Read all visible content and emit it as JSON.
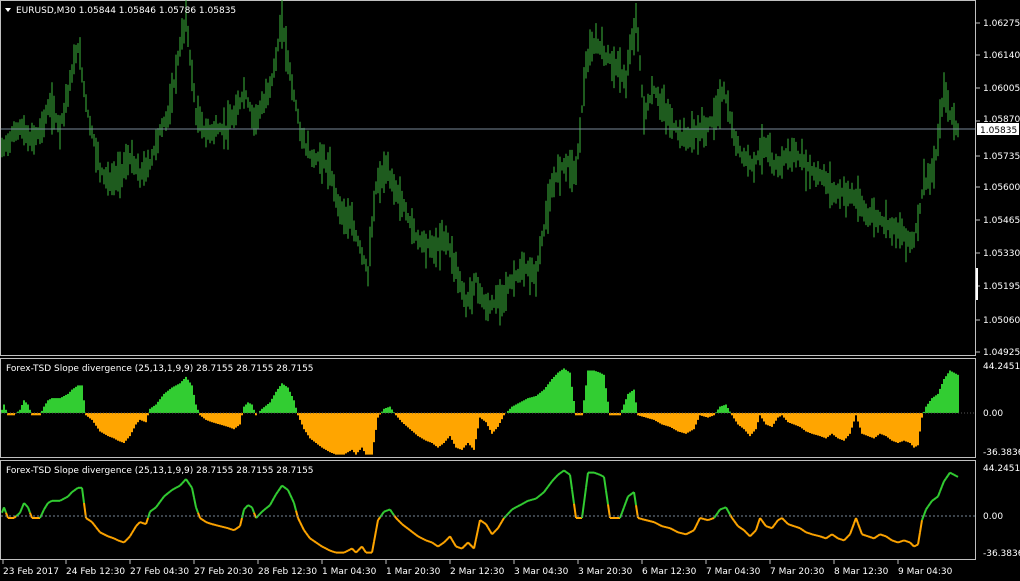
{
  "symbol_header": "EURUSD,M30  1.05844 1.05846 1.05786 1.05835",
  "current_price": "1.05835",
  "colors": {
    "background": "#000000",
    "frame": "#c0c0c0",
    "price_bars": "#3cb63c",
    "positive": "#32cd32",
    "negative": "#ffa500",
    "text": "#ffffff",
    "price_line": "#778899"
  },
  "price_axis": [
    "1.06275",
    "1.06140",
    "1.06005",
    "1.05870",
    "1.05735",
    "1.05600",
    "1.05465",
    "1.05330",
    "1.05195",
    "1.05060",
    "1.04925"
  ],
  "indicator1": {
    "title": "Forex-TSD Slope divergence (25,13,1,9,9) 28.7155 28.7155 28.7155",
    "axis": [
      "44.2451",
      "0.00",
      "-36.3836"
    ]
  },
  "indicator2": {
    "title": "Forex-TSD Slope divergence (25,13,1,9,9) 28.7155 28.7155 28.7155",
    "axis": [
      "44.2451",
      "0.00",
      "-36.3836"
    ]
  },
  "time_axis": [
    "23 Feb 2017",
    "24 Feb 12:30",
    "27 Feb 04:30",
    "27 Feb 20:30",
    "28 Feb 12:30",
    "1 Mar 04:30",
    "1 Mar 20:30",
    "2 Mar 12:30",
    "3 Mar 04:30",
    "3 Mar 20:30",
    "6 Mar 12:30",
    "7 Mar 04:30",
    "7 Mar 20:30",
    "8 Mar 12:30",
    "9 Mar 04:30"
  ],
  "chart_data": {
    "type": "line",
    "price_kp": [
      [
        0,
        1.0574
      ],
      [
        10,
        1.058
      ],
      [
        20,
        1.0585
      ],
      [
        30,
        1.0579
      ],
      [
        40,
        1.0583
      ],
      [
        50,
        1.0594
      ],
      [
        60,
        1.0585
      ],
      [
        70,
        1.0603
      ],
      [
        78,
        1.0618
      ],
      [
        88,
        1.059
      ],
      [
        100,
        1.0568
      ],
      [
        110,
        1.0562
      ],
      [
        120,
        1.0566
      ],
      [
        130,
        1.0572
      ],
      [
        140,
        1.0565
      ],
      [
        150,
        1.057
      ],
      [
        160,
        1.0583
      ],
      [
        170,
        1.0592
      ],
      [
        178,
        1.0613
      ],
      [
        186,
        1.063
      ],
      [
        196,
        1.059
      ],
      [
        206,
        1.0582
      ],
      [
        216,
        1.0584
      ],
      [
        226,
        1.0584
      ],
      [
        236,
        1.059
      ],
      [
        244,
        1.06
      ],
      [
        254,
        1.0588
      ],
      [
        264,
        1.0594
      ],
      [
        274,
        1.0608
      ],
      [
        282,
        1.0628
      ],
      [
        292,
        1.0602
      ],
      [
        302,
        1.058
      ],
      [
        312,
        1.0572
      ],
      [
        322,
        1.0572
      ],
      [
        330,
        1.0566
      ],
      [
        340,
        1.0551
      ],
      [
        350,
        1.0546
      ],
      [
        360,
        1.0536
      ],
      [
        368,
        1.0525
      ],
      [
        376,
        1.056
      ],
      [
        386,
        1.0567
      ],
      [
        396,
        1.0559
      ],
      [
        406,
        1.055
      ],
      [
        416,
        1.054
      ],
      [
        426,
        1.0537
      ],
      [
        436,
        1.0535
      ],
      [
        446,
        1.054
      ],
      [
        456,
        1.0527
      ],
      [
        466,
        1.0512
      ],
      [
        476,
        1.0522
      ],
      [
        486,
        1.051
      ],
      [
        496,
        1.0513
      ],
      [
        506,
        1.0518
      ],
      [
        516,
        1.0524
      ],
      [
        526,
        1.0526
      ],
      [
        536,
        1.0524
      ],
      [
        546,
        1.0548
      ],
      [
        556,
        1.0565
      ],
      [
        566,
        1.0571
      ],
      [
        576,
        1.0566
      ],
      [
        586,
        1.061
      ],
      [
        596,
        1.062
      ],
      [
        606,
        1.0614
      ],
      [
        616,
        1.061
      ],
      [
        626,
        1.0604
      ],
      [
        636,
        1.063
      ],
      [
        644,
        1.059
      ],
      [
        654,
        1.06
      ],
      [
        664,
        1.0592
      ],
      [
        674,
        1.0585
      ],
      [
        684,
        1.058
      ],
      [
        694,
        1.0582
      ],
      [
        704,
        1.0584
      ],
      [
        714,
        1.0588
      ],
      [
        724,
        1.06
      ],
      [
        734,
        1.058
      ],
      [
        744,
        1.0572
      ],
      [
        754,
        1.057
      ],
      [
        764,
        1.0578
      ],
      [
        774,
        1.0568
      ],
      [
        784,
        1.0572
      ],
      [
        794,
        1.0574
      ],
      [
        804,
        1.057
      ],
      [
        814,
        1.0566
      ],
      [
        824,
        1.0564
      ],
      [
        834,
        1.0558
      ],
      [
        844,
        1.0558
      ],
      [
        854,
        1.0556
      ],
      [
        864,
        1.055
      ],
      [
        874,
        1.0548
      ],
      [
        884,
        1.0546
      ],
      [
        894,
        1.0544
      ],
      [
        904,
        1.054
      ],
      [
        914,
        1.0538
      ],
      [
        924,
        1.0562
      ],
      [
        934,
        1.0566
      ],
      [
        944,
        1.06
      ],
      [
        950,
        1.059
      ],
      [
        958,
        1.0584
      ]
    ],
    "osc_kp": [
      [
        0,
        -2
      ],
      [
        4,
        8
      ],
      [
        8,
        -2
      ],
      [
        14,
        -2
      ],
      [
        20,
        3
      ],
      [
        24,
        12
      ],
      [
        28,
        8
      ],
      [
        32,
        -2
      ],
      [
        40,
        -2
      ],
      [
        44,
        6
      ],
      [
        48,
        12
      ],
      [
        52,
        14
      ],
      [
        60,
        14
      ],
      [
        68,
        18
      ],
      [
        72,
        22
      ],
      [
        78,
        26
      ],
      [
        82,
        26
      ],
      [
        86,
        -2
      ],
      [
        92,
        -6
      ],
      [
        100,
        -16
      ],
      [
        108,
        -20
      ],
      [
        114,
        -22
      ],
      [
        118,
        -24
      ],
      [
        124,
        -26
      ],
      [
        130,
        -20
      ],
      [
        136,
        -10
      ],
      [
        140,
        -6
      ],
      [
        146,
        -8
      ],
      [
        150,
        4
      ],
      [
        156,
        8
      ],
      [
        164,
        18
      ],
      [
        172,
        24
      ],
      [
        180,
        28
      ],
      [
        186,
        34
      ],
      [
        192,
        26
      ],
      [
        196,
        8
      ],
      [
        200,
        -2
      ],
      [
        206,
        -6
      ],
      [
        212,
        -8
      ],
      [
        220,
        -10
      ],
      [
        228,
        -12
      ],
      [
        234,
        -14
      ],
      [
        240,
        -10
      ],
      [
        244,
        6
      ],
      [
        248,
        10
      ],
      [
        252,
        8
      ],
      [
        256,
        -2
      ],
      [
        262,
        4
      ],
      [
        270,
        10
      ],
      [
        276,
        20
      ],
      [
        282,
        28
      ],
      [
        288,
        24
      ],
      [
        294,
        12
      ],
      [
        298,
        -2
      ],
      [
        304,
        -14
      ],
      [
        310,
        -22
      ],
      [
        316,
        -26
      ],
      [
        322,
        -30
      ],
      [
        330,
        -34
      ],
      [
        336,
        -36
      ],
      [
        344,
        -36
      ],
      [
        352,
        -32
      ],
      [
        356,
        -36
      ],
      [
        362,
        -30
      ],
      [
        366,
        -36
      ],
      [
        372,
        -36
      ],
      [
        378,
        -4
      ],
      [
        384,
        4
      ],
      [
        390,
        6
      ],
      [
        396,
        -2
      ],
      [
        402,
        -8
      ],
      [
        410,
        -14
      ],
      [
        418,
        -20
      ],
      [
        426,
        -24
      ],
      [
        432,
        -26
      ],
      [
        438,
        -30
      ],
      [
        444,
        -26
      ],
      [
        450,
        -20
      ],
      [
        456,
        -30
      ],
      [
        462,
        -32
      ],
      [
        468,
        -26
      ],
      [
        474,
        -32
      ],
      [
        480,
        -4
      ],
      [
        486,
        -8
      ],
      [
        492,
        -18
      ],
      [
        498,
        -12
      ],
      [
        504,
        -2
      ],
      [
        512,
        6
      ],
      [
        520,
        10
      ],
      [
        528,
        14
      ],
      [
        536,
        16
      ],
      [
        544,
        22
      ],
      [
        552,
        32
      ],
      [
        558,
        38
      ],
      [
        564,
        42
      ],
      [
        570,
        38
      ],
      [
        576,
        -2
      ],
      [
        582,
        -2
      ],
      [
        588,
        40
      ],
      [
        594,
        40
      ],
      [
        600,
        38
      ],
      [
        604,
        36
      ],
      [
        610,
        -2
      ],
      [
        620,
        -2
      ],
      [
        628,
        18
      ],
      [
        634,
        22
      ],
      [
        638,
        -2
      ],
      [
        646,
        -4
      ],
      [
        654,
        -6
      ],
      [
        662,
        -10
      ],
      [
        670,
        -12
      ],
      [
        678,
        -16
      ],
      [
        686,
        -18
      ],
      [
        694,
        -14
      ],
      [
        700,
        -2
      ],
      [
        708,
        -4
      ],
      [
        714,
        -2
      ],
      [
        720,
        6
      ],
      [
        726,
        8
      ],
      [
        732,
        -2
      ],
      [
        738,
        -10
      ],
      [
        744,
        -14
      ],
      [
        750,
        -20
      ],
      [
        756,
        -14
      ],
      [
        760,
        -2
      ],
      [
        766,
        -10
      ],
      [
        772,
        -12
      ],
      [
        778,
        -4
      ],
      [
        782,
        -2
      ],
      [
        788,
        -8
      ],
      [
        794,
        -10
      ],
      [
        800,
        -12
      ],
      [
        806,
        -16
      ],
      [
        812,
        -18
      ],
      [
        820,
        -20
      ],
      [
        826,
        -22
      ],
      [
        832,
        -18
      ],
      [
        838,
        -22
      ],
      [
        844,
        -24
      ],
      [
        850,
        -18
      ],
      [
        856,
        -2
      ],
      [
        862,
        -18
      ],
      [
        868,
        -20
      ],
      [
        874,
        -22
      ],
      [
        880,
        -18
      ],
      [
        886,
        -20
      ],
      [
        892,
        -24
      ],
      [
        898,
        -26
      ],
      [
        904,
        -24
      ],
      [
        910,
        -26
      ],
      [
        914,
        -30
      ],
      [
        918,
        -28
      ],
      [
        922,
        -4
      ],
      [
        926,
        6
      ],
      [
        932,
        14
      ],
      [
        938,
        18
      ],
      [
        944,
        32
      ],
      [
        950,
        40
      ],
      [
        954,
        38
      ],
      [
        958,
        36
      ]
    ]
  }
}
